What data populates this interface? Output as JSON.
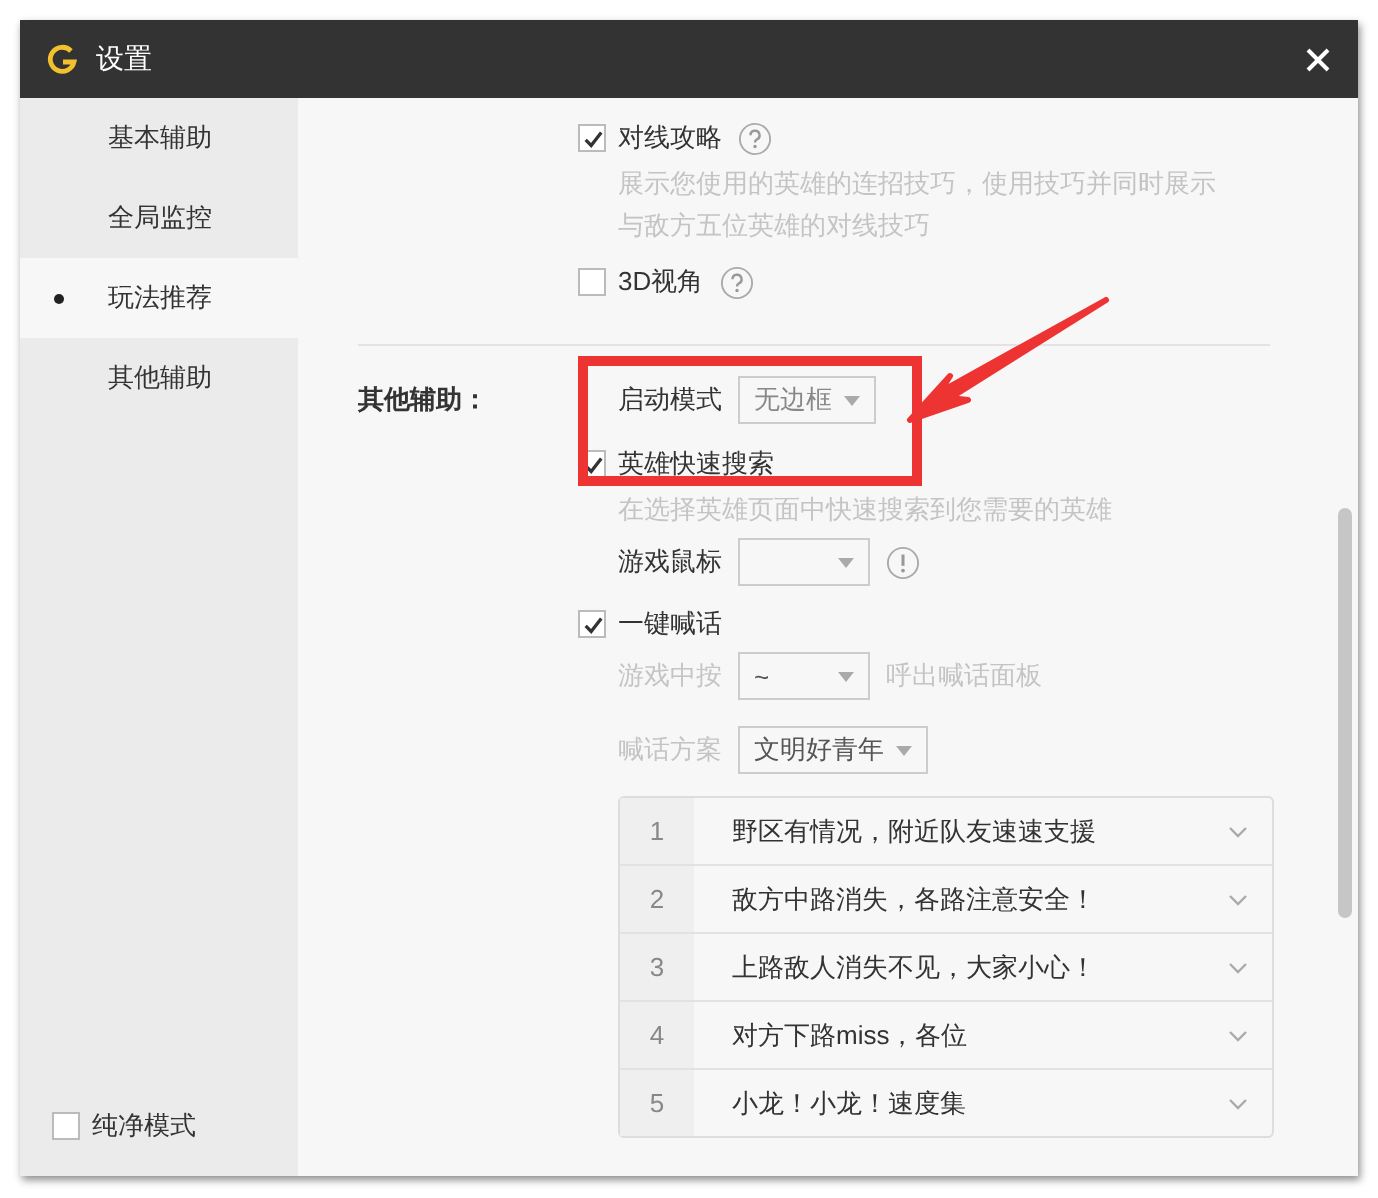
{
  "window": {
    "title": "设置"
  },
  "sidebar": {
    "items": [
      {
        "label": "基本辅助",
        "selected": false
      },
      {
        "label": "全局监控",
        "selected": false
      },
      {
        "label": "玩法推荐",
        "selected": true
      },
      {
        "label": "其他辅助",
        "selected": false
      }
    ],
    "pure_mode": {
      "label": "纯净模式",
      "checked": false
    }
  },
  "sections": [
    {
      "items": [
        {
          "kind": "checkbox",
          "label": "对线攻略",
          "checked": true,
          "help": true,
          "description": "展示您使用的英雄的连招技巧，使用技巧并同时展示与敌方五位英雄的对线技巧"
        },
        {
          "kind": "checkbox",
          "label": "3D视角",
          "checked": false,
          "help": true
        }
      ]
    },
    {
      "label": "其他辅助：",
      "items": [
        {
          "kind": "select",
          "label": "启动模式",
          "value": "无边框",
          "disabled": false
        },
        {
          "kind": "checkbox",
          "label": "英雄快速搜索",
          "checked": true,
          "help": false,
          "description": "在选择英雄页面中快速搜索到您需要的英雄"
        },
        {
          "kind": "select",
          "label": "游戏鼠标",
          "disabled": false,
          "info": true
        },
        {
          "kind": "checkbox",
          "label": "一键喊话",
          "checked": true,
          "help": false
        },
        {
          "kind": "select",
          "label": "游戏中按",
          "value": "~",
          "suffix": "呼出喊话面板",
          "disabled": true
        },
        {
          "kind": "select",
          "label": "喊话方案",
          "value": "文明好青年",
          "disabled": true
        },
        {
          "kind": "phrases",
          "rows": [
            {
              "number": "1",
              "text": "野区有情况，附近队友速速支援"
            },
            {
              "number": "2",
              "text": "敌方中路消失，各路注意安全！"
            },
            {
              "number": "3",
              "text": "上路敌人消失不见，大家小心！"
            },
            {
              "number": "4",
              "text": "对方下路miss，各位"
            },
            {
              "number": "5",
              "text": "小龙！小龙！速度集"
            }
          ]
        }
      ]
    }
  ]
}
